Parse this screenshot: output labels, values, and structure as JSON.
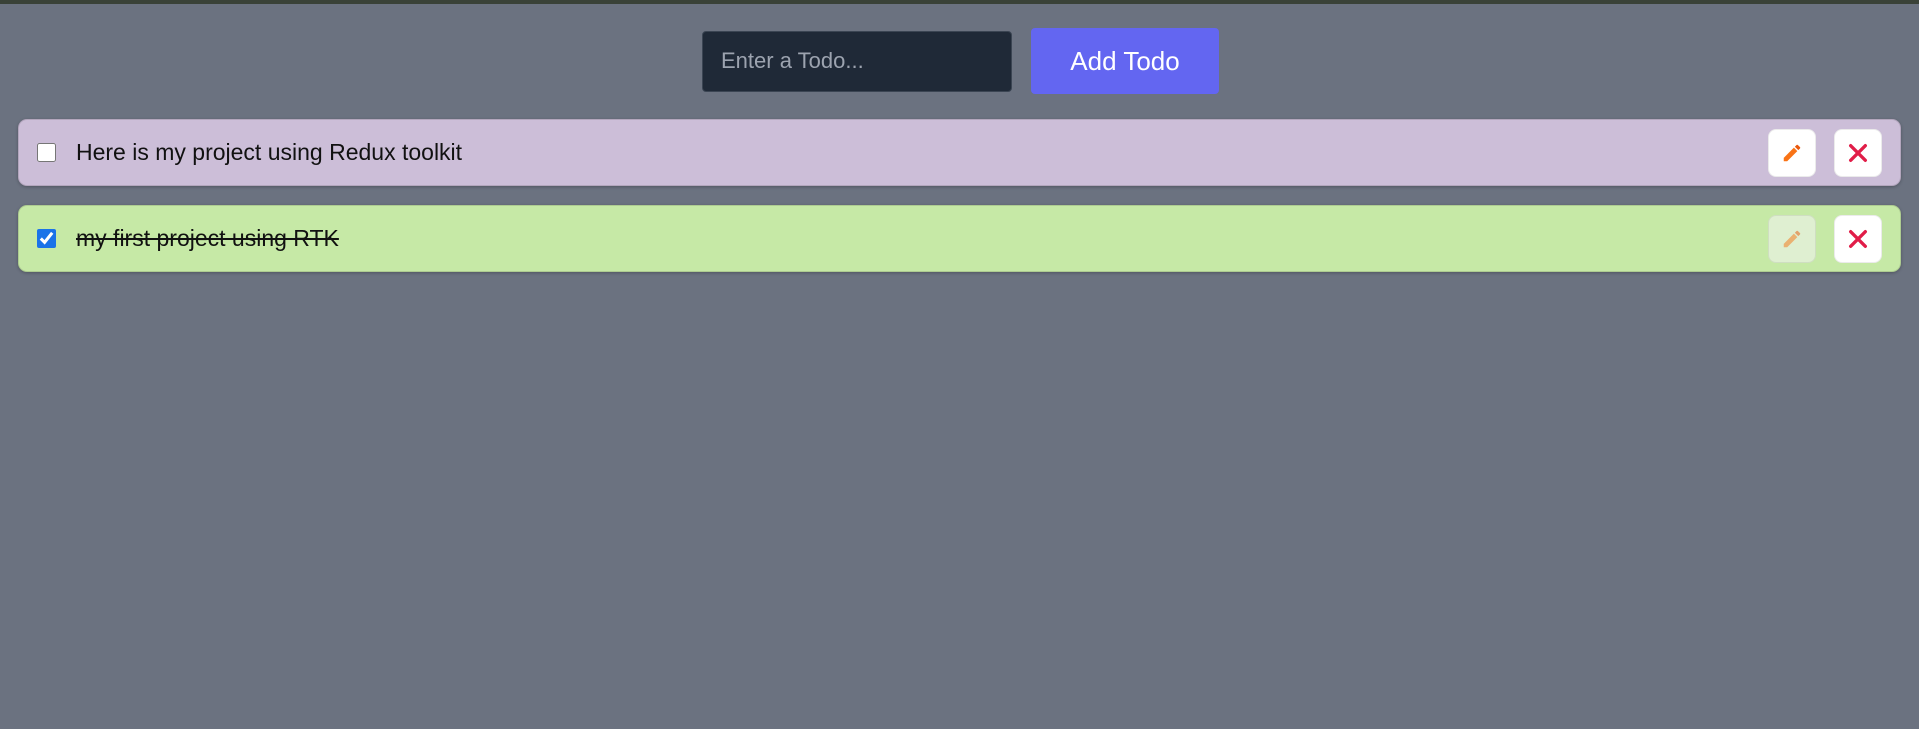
{
  "form": {
    "input_value": "",
    "input_placeholder": "Enter a Todo...",
    "add_label": "Add Todo"
  },
  "todos": [
    {
      "text": "Here is my project using Redux toolkit",
      "completed": false,
      "edit_icon": "pencil-icon",
      "delete_icon": "close-icon"
    },
    {
      "text": "my first project using RTK",
      "completed": true,
      "edit_icon": "pencil-icon",
      "delete_icon": "close-icon"
    }
  ],
  "colors": {
    "background": "#6b7280",
    "input_bg": "#1f2937",
    "add_button": "#6366f1",
    "pending_item": "#ccbed8",
    "completed_item": "#c6e9a6",
    "pencil_icon": "#f97316",
    "close_icon": "#e11d48"
  }
}
